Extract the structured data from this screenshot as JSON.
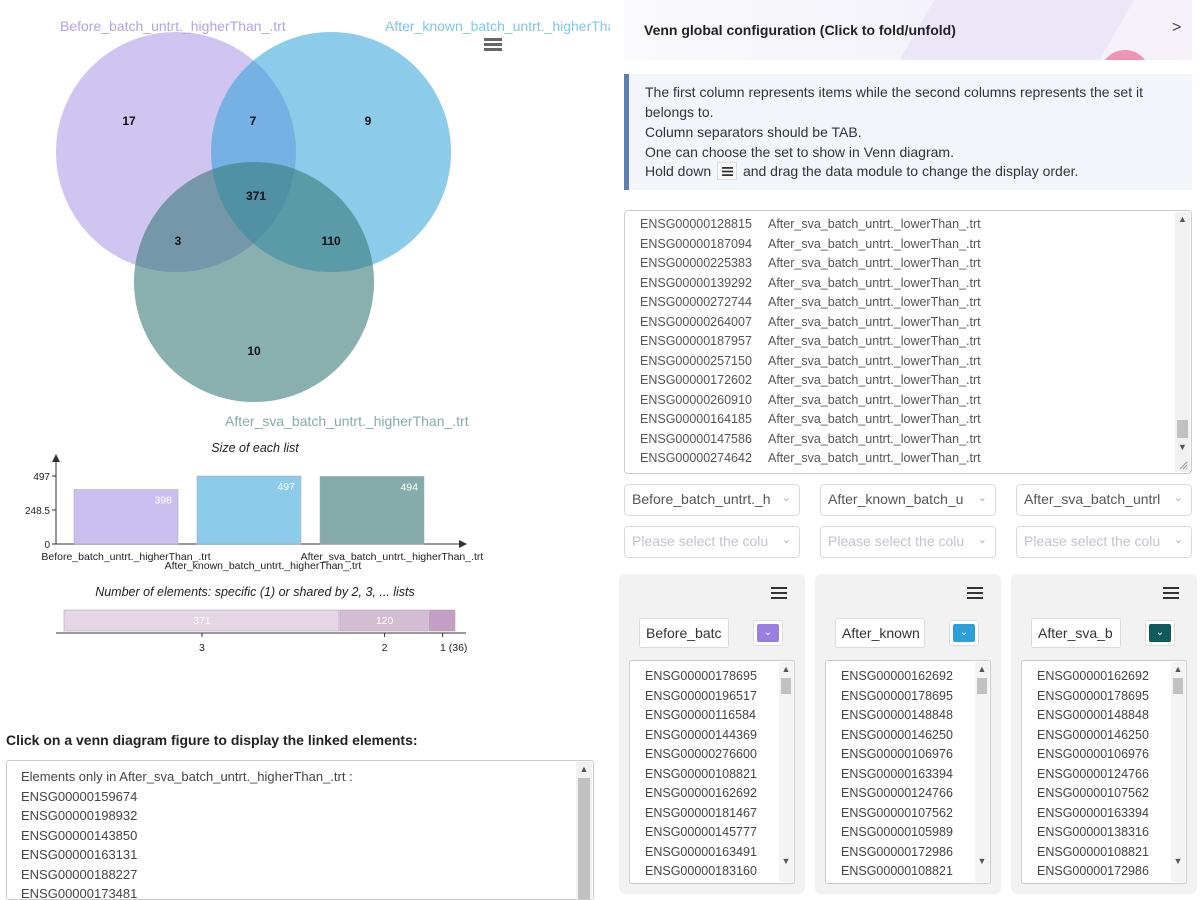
{
  "venn": {
    "sets": [
      {
        "name": "Before_batch_untrt._higherThan_.trt",
        "color": "#a993e3"
      },
      {
        "name": "After_known_batch_untrt._higherThan_.trt",
        "color": "#2ea3d8"
      },
      {
        "name": "After_sva_batch_untrt._higherThan_.trt",
        "color": "#3a7a7a"
      }
    ],
    "regions": [
      {
        "sets": "A",
        "count": "17"
      },
      {
        "sets": "AB",
        "count": "7"
      },
      {
        "sets": "B",
        "count": "9"
      },
      {
        "sets": "ABC",
        "count": "371"
      },
      {
        "sets": "AC",
        "count": "3"
      },
      {
        "sets": "BC",
        "count": "110"
      },
      {
        "sets": "C",
        "count": "10"
      }
    ],
    "menu_icon": "hamburger-menu-icon"
  },
  "chart_data": [
    {
      "type": "bar",
      "title": "Size of each list",
      "categories": [
        "Before_batch_untrt._higherThan_.trt",
        "After_known_batch_untrt._higherThan_.trt",
        "After_sva_batch_untrt._higherThan_.trt"
      ],
      "values": [
        398,
        497,
        494
      ],
      "colors": [
        "#cbbff0",
        "#8dcbea",
        "#86abab"
      ],
      "ylim": [
        0,
        497
      ],
      "yticks": [
        "0",
        "248.5",
        "497"
      ]
    },
    {
      "type": "bar",
      "orientation": "horizontal-stacked",
      "title": "Number of elements: specific (1) or shared by 2, 3, ... lists",
      "categories": [
        "3",
        "2",
        "1 (36)"
      ],
      "values": [
        371,
        120,
        36
      ],
      "data_labels": [
        "371",
        "120",
        ""
      ],
      "colors": [
        "#e4d6e4",
        "#d3bdd3",
        "#c39fc3"
      ]
    }
  ],
  "linked": {
    "title": "Click on a venn diagram figure to display the linked elements:",
    "header": "Elements only in After_sva_batch_untrt._higherThan_.trt :",
    "items": [
      "ENSG00000159674",
      "ENSG00000198932",
      "ENSG00000143850",
      "ENSG00000163131",
      "ENSG00000188227",
      "ENSG00000173481"
    ]
  },
  "config": {
    "title": "Venn global configuration (Click to fold/unfold)",
    "chevron": ">",
    "info": {
      "line1": "The first column represents items while the second columns represents the set it",
      "line2": "belongs to.",
      "line3": "Column separators should be TAB.",
      "line4": "One can choose the set to show in Venn diagram.",
      "line5_pre": "Hold down",
      "line5_post": "and drag the data module to change the display order."
    },
    "data_rows": [
      {
        "gene": "ENSG00000128815",
        "set": "After_sva_batch_untrt._lowerThan_.trt"
      },
      {
        "gene": "ENSG00000187094",
        "set": "After_sva_batch_untrt._lowerThan_.trt"
      },
      {
        "gene": "ENSG00000225383",
        "set": "After_sva_batch_untrt._lowerThan_.trt"
      },
      {
        "gene": "ENSG00000139292",
        "set": "After_sva_batch_untrt._lowerThan_.trt"
      },
      {
        "gene": "ENSG00000272744",
        "set": "After_sva_batch_untrt._lowerThan_.trt"
      },
      {
        "gene": "ENSG00000264007",
        "set": "After_sva_batch_untrt._lowerThan_.trt"
      },
      {
        "gene": "ENSG00000187957",
        "set": "After_sva_batch_untrt._lowerThan_.trt"
      },
      {
        "gene": "ENSG00000257150",
        "set": "After_sva_batch_untrt._lowerThan_.trt"
      },
      {
        "gene": "ENSG00000172602",
        "set": "After_sva_batch_untrt._lowerThan_.trt"
      },
      {
        "gene": "ENSG00000260910",
        "set": "After_sva_batch_untrt._lowerThan_.trt"
      },
      {
        "gene": "ENSG00000164185",
        "set": "After_sva_batch_untrt._lowerThan_.trt"
      },
      {
        "gene": "ENSG00000147586",
        "set": "After_sva_batch_untrt._lowerThan_.trt"
      },
      {
        "gene": "ENSG00000274642",
        "set": "After_sva_batch_untrt._lowerThan_.trt"
      }
    ],
    "set_selects": [
      "Before_batch_untrt._h",
      "After_known_batch_u",
      "After_sva_batch_untrl"
    ],
    "column_selects_placeholder": "Please select the colu"
  },
  "cards": [
    {
      "name": "Before_batc",
      "color": "#9b7fe0",
      "genes": [
        "ENSG00000178695",
        "ENSG00000196517",
        "ENSG00000116584",
        "ENSG00000144369",
        "ENSG00000276600",
        "ENSG00000108821",
        "ENSG00000162692",
        "ENSG00000181467",
        "ENSG00000145777",
        "ENSG00000163491",
        "ENSG00000183160"
      ]
    },
    {
      "name": "After_known",
      "color": "#2c9fdb",
      "genes": [
        "ENSG00000162692",
        "ENSG00000178695",
        "ENSG00000148848",
        "ENSG00000146250",
        "ENSG00000106976",
        "ENSG00000163394",
        "ENSG00000124766",
        "ENSG00000107562",
        "ENSG00000105989",
        "ENSG00000172986",
        "ENSG00000108821"
      ]
    },
    {
      "name": "After_sva_b",
      "color": "#0f5a5a",
      "genes": [
        "ENSG00000162692",
        "ENSG00000178695",
        "ENSG00000148848",
        "ENSG00000146250",
        "ENSG00000106976",
        "ENSG00000124766",
        "ENSG00000107562",
        "ENSG00000163394",
        "ENSG00000138316",
        "ENSG00000108821",
        "ENSG00000172986"
      ]
    }
  ]
}
